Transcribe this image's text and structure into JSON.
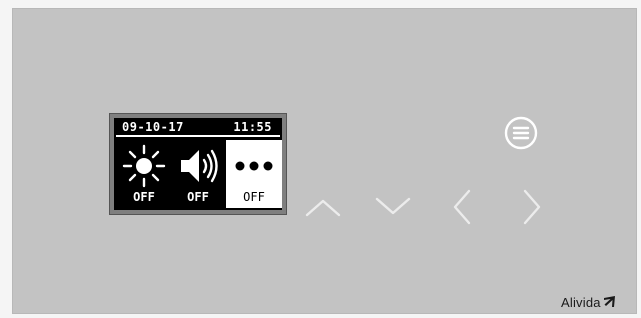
{
  "display": {
    "date": "09-10-17",
    "time": "11:55",
    "tiles": [
      {
        "icon": "sun-icon",
        "label": "OFF"
      },
      {
        "icon": "speaker-icon",
        "label": "OFF"
      },
      {
        "icon": "more-dots-icon",
        "label": "OFF",
        "selected": true
      }
    ]
  },
  "controls": {
    "menu": "menu-lines-icon",
    "up": "chevron-up-icon",
    "down": "chevron-down-icon",
    "left": "chevron-left-icon",
    "right": "chevron-right-icon"
  },
  "brand": {
    "name": "Alivida",
    "logo": "alivida-logo-icon"
  },
  "colors": {
    "panel": "#c3c3c3",
    "screen": "#000000",
    "screen_text": "#ffffff",
    "touch_glyphs": "#ffffff"
  }
}
